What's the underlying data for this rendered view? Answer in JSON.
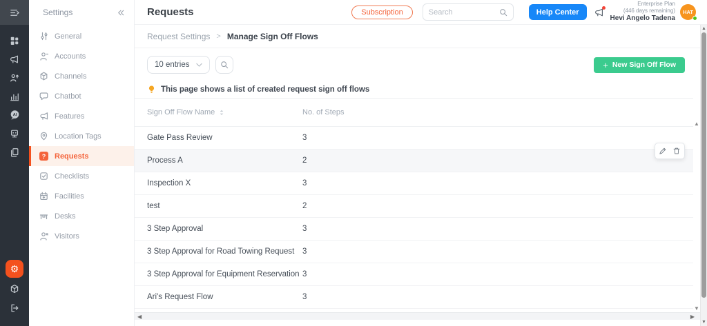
{
  "colors": {
    "brand_orange": "#F4511E",
    "active_orange": "#F4633A",
    "help_blue": "#1787F8",
    "button_green": "#3BCB8E",
    "avatar_orange": "#F7941E",
    "presence_green": "#52C41A",
    "bulb_yellow": "#F5A623",
    "rail_bg": "#2B3139"
  },
  "icons": {
    "gear_glyph": "⚙",
    "question_glyph": "?",
    "arrow_up": "▲",
    "arrow_down": "▼",
    "arrow_left": "◀",
    "arrow_right": "▶"
  },
  "sidebar": {
    "title": "Settings",
    "items": [
      {
        "label": "General"
      },
      {
        "label": "Accounts"
      },
      {
        "label": "Channels"
      },
      {
        "label": "Chatbot"
      },
      {
        "label": "Features"
      },
      {
        "label": "Location Tags"
      },
      {
        "label": "Requests",
        "active": true
      },
      {
        "label": "Checklists"
      },
      {
        "label": "Facilities"
      },
      {
        "label": "Desks"
      },
      {
        "label": "Visitors"
      }
    ]
  },
  "topbar": {
    "title": "Requests",
    "subscription_label": "Subscription",
    "search_placeholder": "Search",
    "help_center_label": "Help Center",
    "plan_name": "Enterprise Plan",
    "plan_remaining": "(446 days remaining)",
    "user_name": "Hevi Angelo Tadena",
    "avatar_initials": "HAT"
  },
  "breadcrumb": {
    "parent": "Request Settings",
    "separator": ">",
    "current": "Manage Sign Off Flows"
  },
  "toolbar": {
    "entries_label": "10 entries",
    "plus": "+",
    "new_flow_label": "New Sign Off Flow"
  },
  "note": {
    "text": "This page shows a list of created request sign off flows"
  },
  "table": {
    "columns": [
      "Sign Off Flow Name",
      "No. of Steps"
    ],
    "rows": [
      {
        "name": "Gate Pass Review",
        "steps": "3"
      },
      {
        "name": "Process A",
        "steps": "2",
        "hovered": true
      },
      {
        "name": "Inspection X",
        "steps": "3"
      },
      {
        "name": "test",
        "steps": "2"
      },
      {
        "name": "3 Step Approval",
        "steps": "3"
      },
      {
        "name": "3 Step Approval for Road Towing Request",
        "steps": "3"
      },
      {
        "name": "3 Step Approval for Equipment Reservation",
        "steps": "3"
      },
      {
        "name": "Ari's Request Flow",
        "steps": "3"
      }
    ]
  }
}
